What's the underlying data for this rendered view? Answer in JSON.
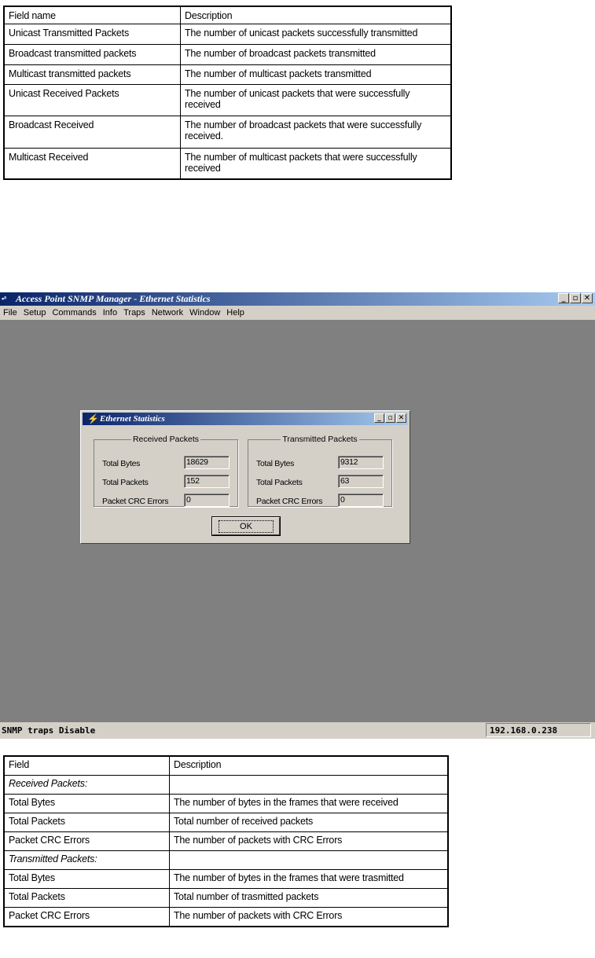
{
  "fields_table": {
    "header": [
      "Field name",
      "Description"
    ],
    "rows": [
      [
        "Unicast Transmitted Packets",
        "The number of unicast packets successfully transmitted"
      ],
      [
        "Broadcast transmitted packets",
        "The number of broadcast packets transmitted"
      ],
      [
        "Multicast transmitted packets",
        "The number of multicast packets transmitted"
      ],
      [
        "Unicast Received Packets",
        "The number of unicast packets that were successfully received"
      ],
      [
        "Broadcast Received",
        "The number of broadcast packets that were successfully received."
      ],
      [
        "Multicast Received",
        "The number of multicast packets that were successfully received"
      ]
    ]
  },
  "app": {
    "title": "Access Point SNMP Manager - Ethernet Statistics",
    "menu": [
      "File",
      "Setup",
      "Commands",
      "Info",
      "Traps",
      "Network",
      "Window",
      "Help"
    ],
    "window_buttons": {
      "minimize": "_",
      "maximize": "▫",
      "close": "✕"
    },
    "status_left": "SNMP traps Disable",
    "status_right": "192.168.0.238"
  },
  "dialog": {
    "title": "Ethernet Statistics",
    "received": {
      "legend": "Received Packets",
      "total_bytes_label": "Total Bytes",
      "total_bytes": "18629",
      "total_packets_label": "Total Packets",
      "total_packets": "152",
      "crc_label": "Packet CRC Errors",
      "crc": "0"
    },
    "transmitted": {
      "legend": "Transmitted Packets",
      "total_bytes_label": "Total Bytes",
      "total_bytes": "9312",
      "total_packets_label": "Total Packets",
      "total_packets": "63",
      "crc_label": "Packet CRC Errors",
      "crc": "0"
    },
    "ok_label": "OK"
  },
  "stats_table": {
    "header": [
      "Field",
      "Description"
    ],
    "rows": [
      [
        "Received Packets:",
        ""
      ],
      [
        "Total Bytes",
        "The number of bytes in the frames that were received"
      ],
      [
        "Total Packets",
        "Total number of received packets"
      ],
      [
        "Packet CRC Errors",
        "The number of packets with CRC Errors"
      ],
      [
        "Transmitted Packets:",
        ""
      ],
      [
        "Total Bytes",
        "The number of bytes in the frames that were trasmitted"
      ],
      [
        "Total Packets",
        "Total number of trasmitted packets"
      ],
      [
        "Packet CRC Errors",
        "The number of packets with CRC Errors"
      ]
    ]
  },
  "icons": {
    "app_icon": "network-icon",
    "dialog_icon": "lightning-icon"
  }
}
